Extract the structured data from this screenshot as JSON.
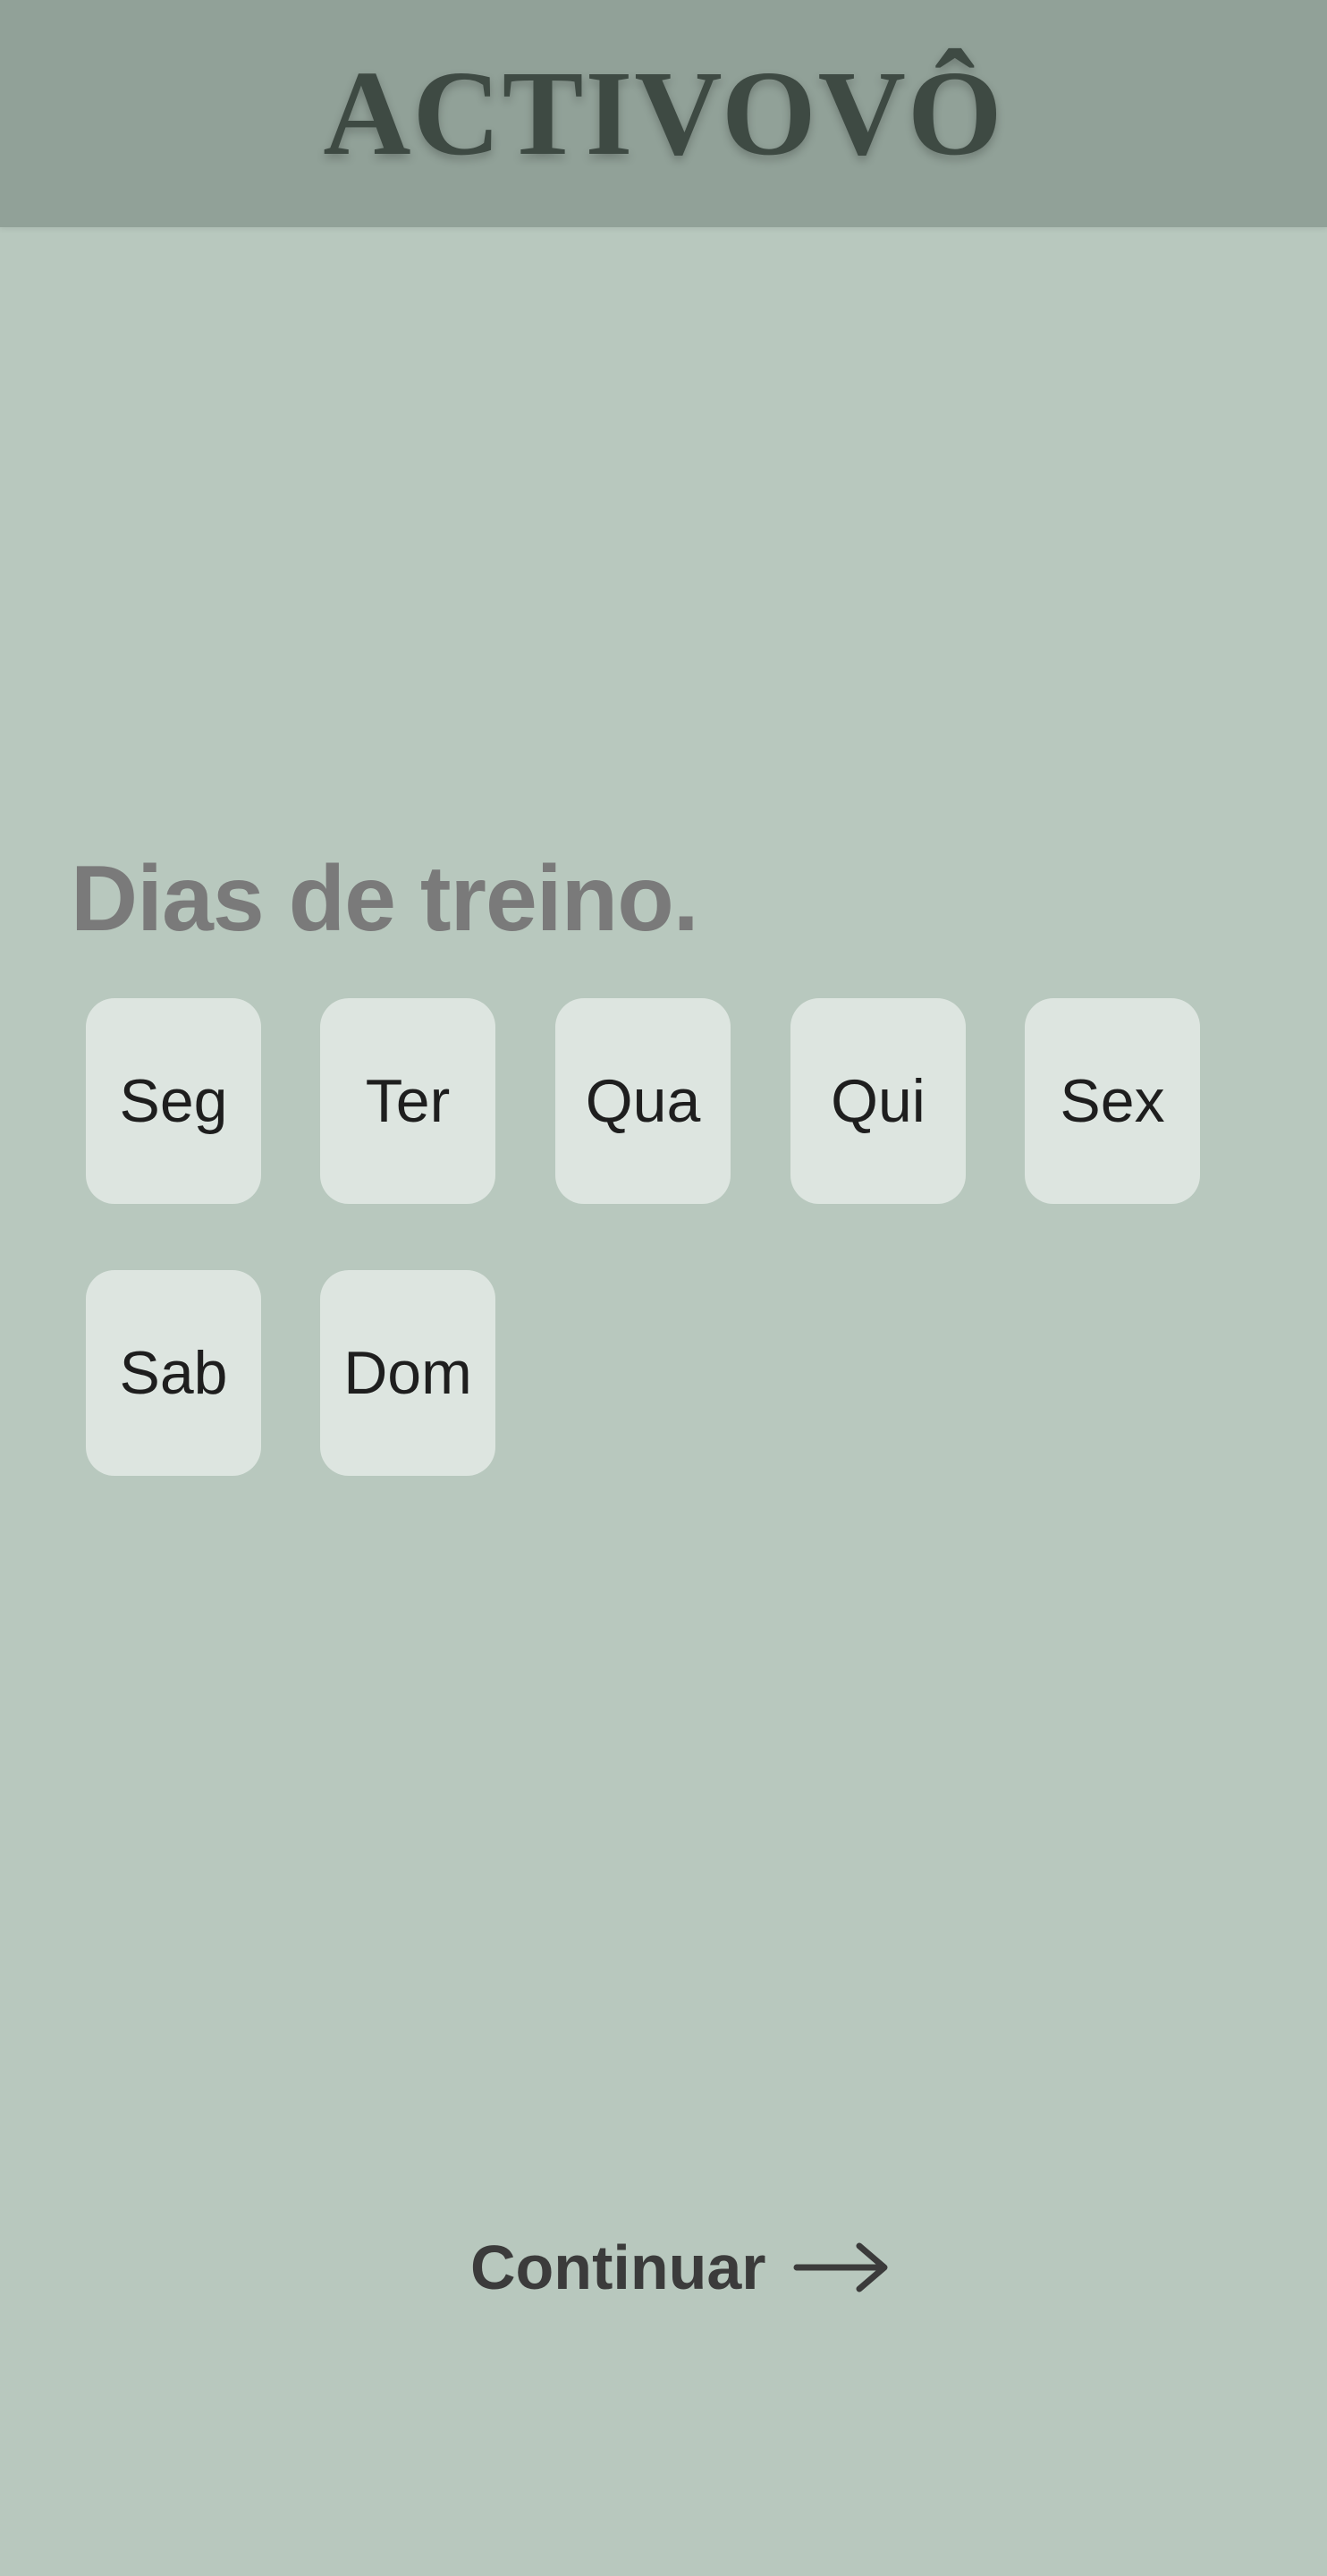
{
  "header": {
    "app_title": "ACTIVOVÔ",
    "background_color": "#91a198"
  },
  "main": {
    "title": "Dias de treino.",
    "days": [
      {
        "label": "Seg"
      },
      {
        "label": "Ter"
      },
      {
        "label": "Qua"
      },
      {
        "label": "Qui"
      },
      {
        "label": "Sex"
      },
      {
        "label": "Sab"
      },
      {
        "label": "Dom"
      }
    ]
  },
  "footer": {
    "continue_label": "Continuar",
    "continue_icon": "arrow-right-icon"
  },
  "colors": {
    "background": "#b8c8be",
    "day_tile": "#dde5e0",
    "title_text": "#7a7a7a"
  }
}
